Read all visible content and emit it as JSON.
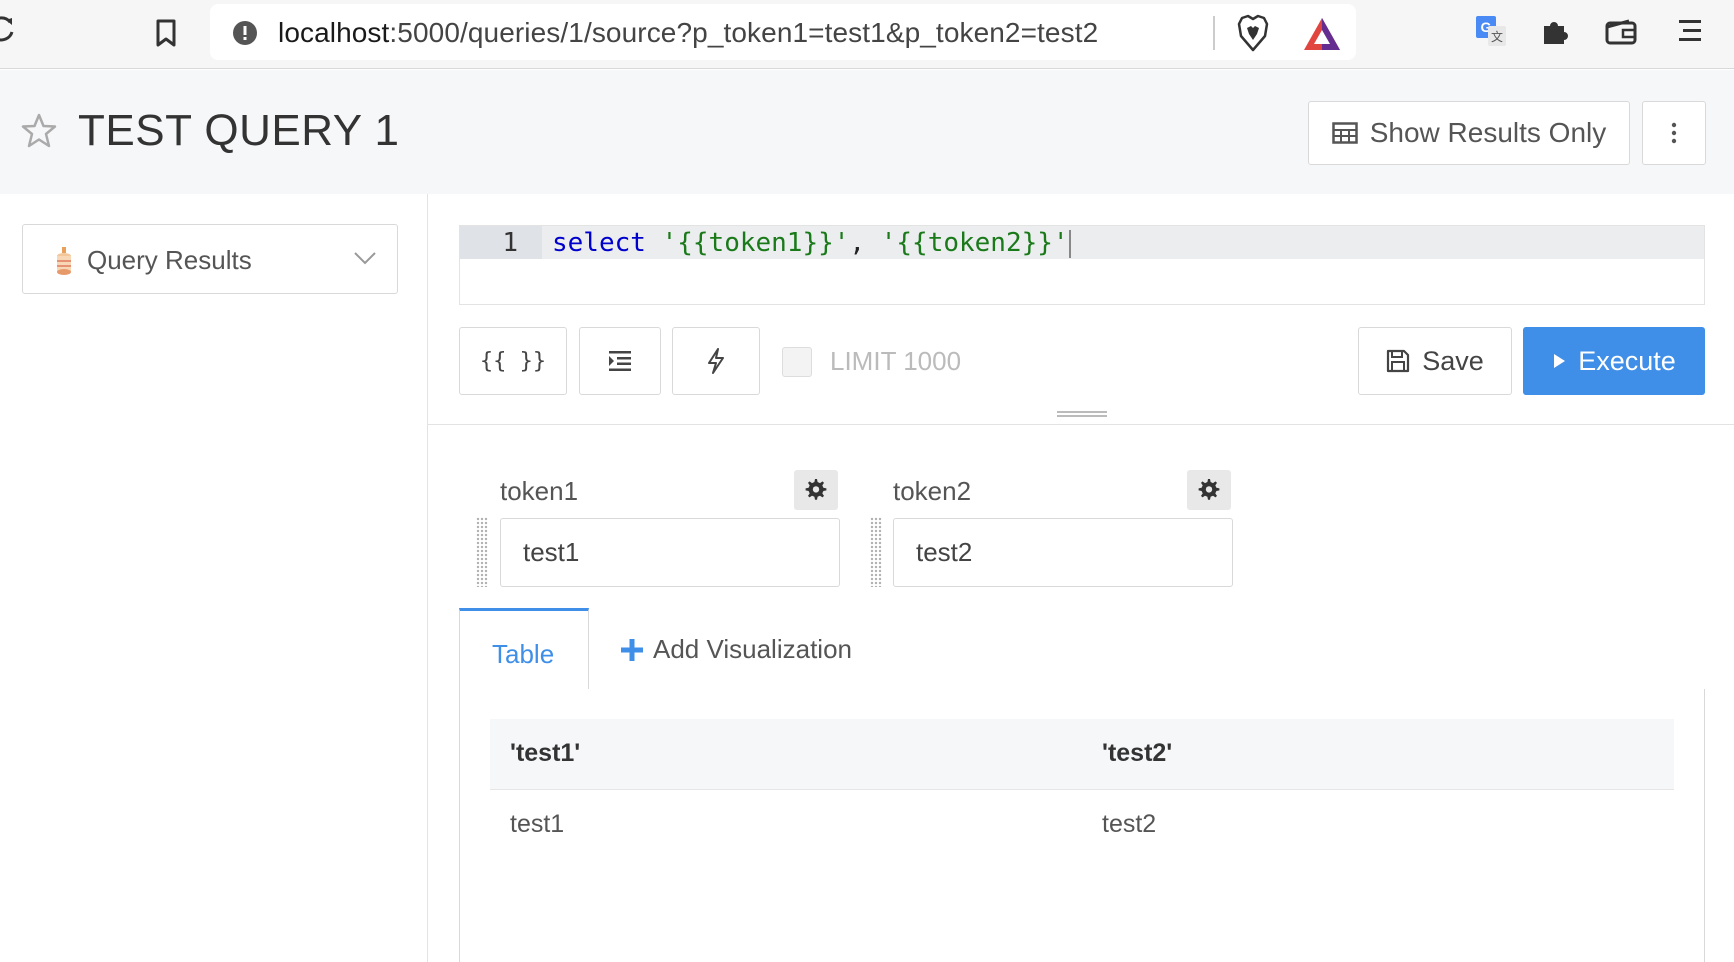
{
  "browser": {
    "url_host": "localhost",
    "url_rest": ":5000/queries/1/source?p_token1=test1&p_token2=test2"
  },
  "header": {
    "title": "TEST QUERY 1",
    "show_results_label": "Show Results Only"
  },
  "sidebar": {
    "schema_select_label": "Query Results"
  },
  "editor": {
    "line_number": "1",
    "code": {
      "keyword": "select",
      "space": " ",
      "string1": "'{{token1}}'",
      "comma": ", ",
      "string2": "'{{token2}}'"
    }
  },
  "toolbar": {
    "params_label": "{{ }}",
    "limit_label": "LIMIT 1000",
    "save_label": "Save",
    "execute_label": "Execute"
  },
  "parameters": [
    {
      "name": "token1",
      "value": "test1"
    },
    {
      "name": "token2",
      "value": "test2"
    }
  ],
  "tabs": {
    "table_label": "Table",
    "add_label": "Add Visualization"
  },
  "results": {
    "columns": [
      "'test1'",
      "'test2'"
    ],
    "rows": [
      [
        "test1",
        "test2"
      ]
    ]
  },
  "colors": {
    "accent": "#3f8fe8",
    "keyword": "#0000cc",
    "string": "#1a7a1a"
  }
}
